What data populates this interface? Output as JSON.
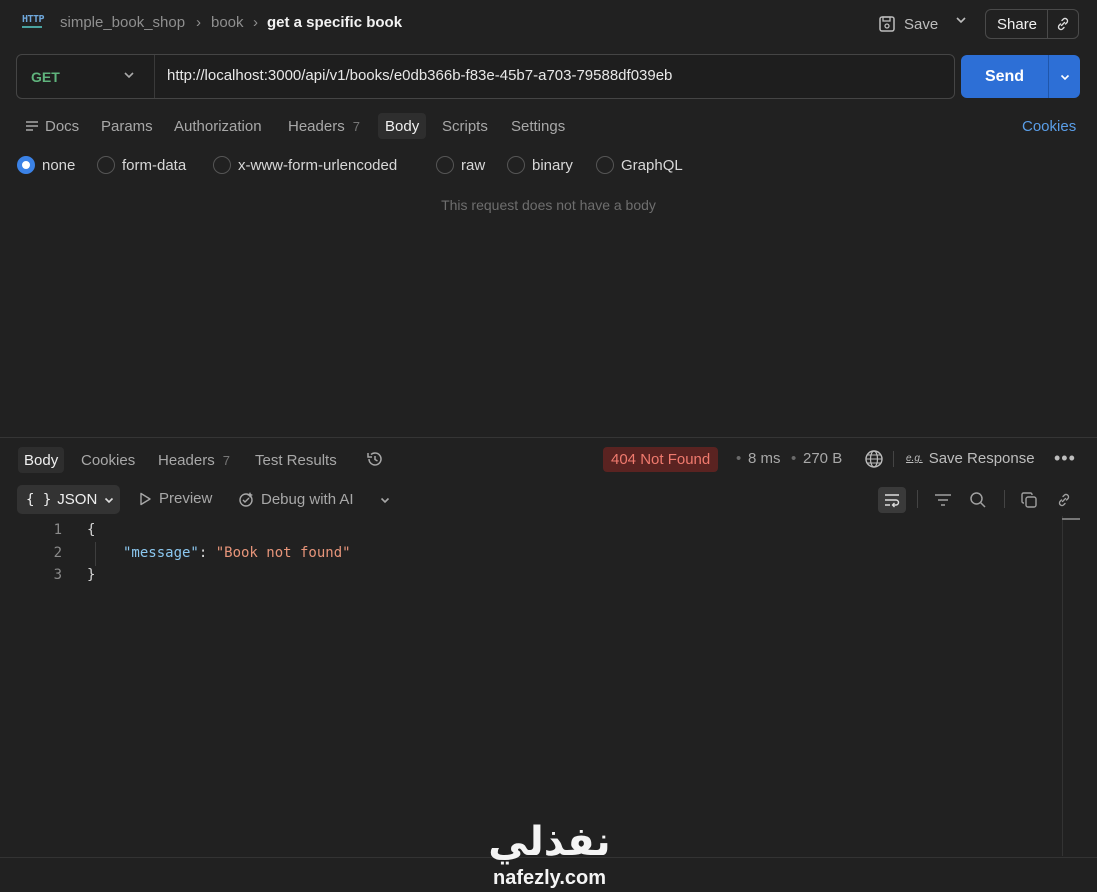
{
  "header": {
    "protocol_icon": "http-icon",
    "breadcrumb": [
      "simple_book_shop",
      "book"
    ],
    "current": "get a specific book",
    "save_label": "Save",
    "share_label": "Share"
  },
  "request": {
    "method": "GET",
    "url": "http://localhost:3000/api/v1/books/e0db366b-f83e-45b7-a703-79588df039eb",
    "send_label": "Send"
  },
  "request_tabs": {
    "docs": "Docs",
    "params": "Params",
    "authorization": "Authorization",
    "headers": "Headers",
    "headers_count": "7",
    "body": "Body",
    "scripts": "Scripts",
    "settings": "Settings",
    "cookies": "Cookies"
  },
  "body_types": {
    "none": "none",
    "form_data": "form-data",
    "urlencoded": "x-www-form-urlencoded",
    "raw": "raw",
    "binary": "binary",
    "graphql": "GraphQL",
    "selected": "none",
    "empty_message": "This request does not have a body"
  },
  "response": {
    "tabs": {
      "body": "Body",
      "cookies": "Cookies",
      "headers": "Headers",
      "headers_count": "7",
      "tests": "Test Results"
    },
    "status": "404 Not Found",
    "time": "8 ms",
    "size": "270 B",
    "save_label": "Save Response",
    "eg_label": "e.g.",
    "format": "JSON",
    "format_icon": "{ }",
    "preview": "Preview",
    "debug": "Debug with AI",
    "lines": [
      {
        "num": "1",
        "open": "{"
      },
      {
        "num": "2",
        "key": "\"message\"",
        "colon": ": ",
        "value": "\"Book not found\""
      },
      {
        "num": "3",
        "close": "}"
      }
    ]
  },
  "watermark": {
    "arabic": "نفذلي",
    "latin": "nafezly.com"
  },
  "colors": {
    "accent": "#2d6fd6",
    "method": "#5fb37c",
    "error": "#f07a6e",
    "link": "#5a9ee8"
  }
}
